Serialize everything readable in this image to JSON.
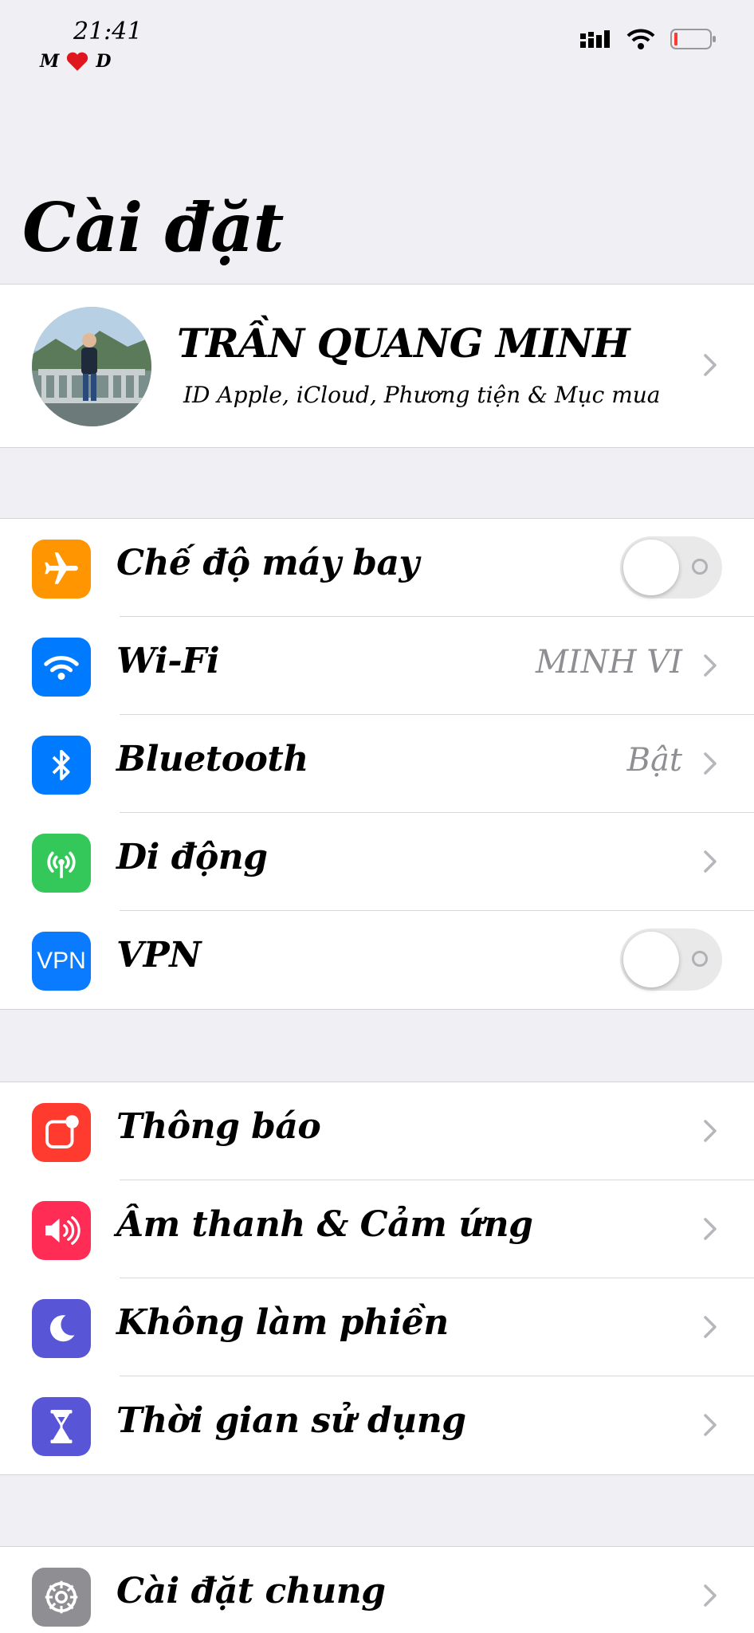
{
  "status_bar": {
    "time": "21:41",
    "carrier_left": "M",
    "carrier_right": "D"
  },
  "page_title": "Cài đặt",
  "profile": {
    "name": "TRẦN QUANG MINH",
    "subtitle": "ID Apple, iCloud, Phương tiện & Mục mua"
  },
  "connectivity": [
    {
      "label": "Chế độ máy bay",
      "icon": "airplane-icon",
      "color": "#ff9500",
      "toggle": false
    },
    {
      "label": "Wi-Fi",
      "icon": "wifi-icon",
      "color": "#007aff",
      "value": "MINH VI"
    },
    {
      "label": "Bluetooth",
      "icon": "bluetooth-icon",
      "color": "#007aff",
      "value": "Bật"
    },
    {
      "label": "Di động",
      "icon": "cellular-icon",
      "color": "#34c759"
    },
    {
      "label": "VPN",
      "icon": "vpn-icon",
      "color": "#0a7aff",
      "icon_text": "VPN",
      "toggle": false
    }
  ],
  "notifications_group": [
    {
      "label": "Thông báo",
      "icon": "notifications-icon",
      "color": "#ff3b30"
    },
    {
      "label": "Âm thanh & Cảm ứng",
      "icon": "sound-icon",
      "color": "#ff2d55"
    },
    {
      "label": "Không làm phiền",
      "icon": "moon-icon",
      "color": "#5856d6"
    },
    {
      "label": "Thời gian sử dụng",
      "icon": "hourglass-icon",
      "color": "#5856d6"
    }
  ],
  "general_group": [
    {
      "label": "Cài đặt chung",
      "icon": "gear-icon",
      "color": "#8e8e93"
    }
  ]
}
